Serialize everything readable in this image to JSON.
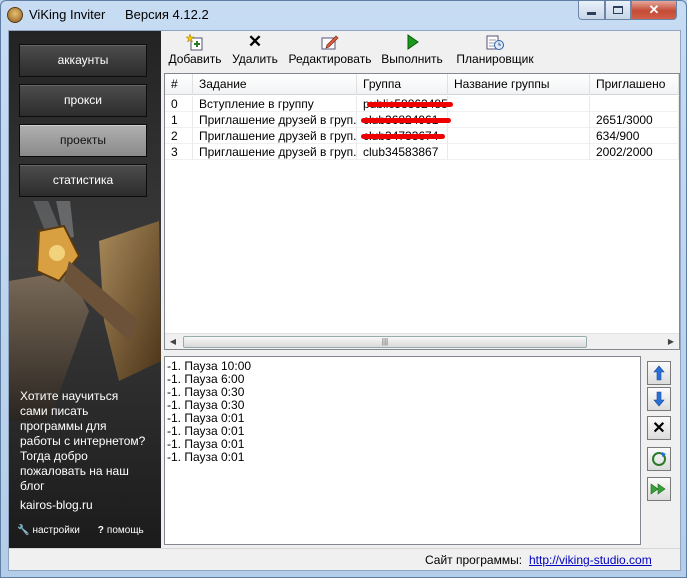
{
  "window": {
    "title": "ViKing Inviter",
    "version": "Версия 4.12.2"
  },
  "sidebar": {
    "items": [
      {
        "label": "аккаунты",
        "active": false
      },
      {
        "label": "прокси",
        "active": false
      },
      {
        "label": "проекты",
        "active": true
      },
      {
        "label": "статистика",
        "active": false
      }
    ],
    "promo_text": "Хотите научиться сами писать программы для работы с интернетом? Тогда добро пожаловать на наш блог",
    "promo_link": "kairos-blog.ru",
    "settings_label": "настройки",
    "help_label": "помощь"
  },
  "toolbar": {
    "add": "Добавить",
    "delete": "Удалить",
    "edit": "Редактировать",
    "run": "Выполнить",
    "scheduler": "Планировщик"
  },
  "table": {
    "columns": [
      "#",
      "Задание",
      "Группа",
      "Название группы",
      "Приглашено"
    ],
    "rows": [
      {
        "num": "0",
        "task": "Вступление в группу",
        "group": "public58862485",
        "group_name": "",
        "invited": ""
      },
      {
        "num": "1",
        "task": "Приглашение друзей в груп...",
        "group": "club36824961",
        "group_name": "",
        "invited": "2651/3000"
      },
      {
        "num": "2",
        "task": "Приглашение друзей в груп...",
        "group": "club34733674",
        "group_name": "",
        "invited": "634/900"
      },
      {
        "num": "3",
        "task": "Приглашение друзей в груп...",
        "group": "club34583867",
        "group_name": "",
        "invited": "2002/2000"
      }
    ]
  },
  "log": {
    "lines": [
      "-1. Пауза 10:00",
      "-1. Пауза 6:00",
      "-1. Пауза 0:30",
      "-1. Пауза 0:30",
      "-1. Пауза 0:01",
      "-1. Пауза 0:01",
      "-1. Пауза 0:01",
      "-1. Пауза 0:01"
    ]
  },
  "status": {
    "label": "Сайт программы:",
    "link": "http://viking-studio.com"
  },
  "colors": {
    "redaction": "#e00000",
    "run_icon": "#1a9a1a",
    "arrow_icon": "#2a6fd6"
  }
}
